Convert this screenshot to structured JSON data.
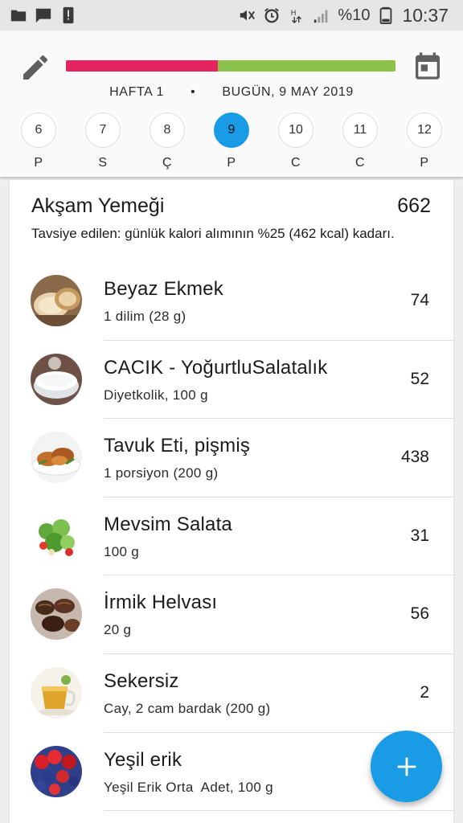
{
  "status_bar": {
    "battery_text": "%10",
    "time": "10:37",
    "left_icons": [
      "folder-icon",
      "chat-icon",
      "alert-icon"
    ],
    "right_icons": [
      "mute-icon",
      "alarm-icon",
      "data-icon",
      "signal-icon",
      "battery-icon"
    ]
  },
  "header": {
    "week_label": "HAFTA 1",
    "separator": "•",
    "date_label": "BUGÜN, 9 MAY 2019",
    "progress": {
      "consumed_fraction": 0.46,
      "consumed_color": "#e5245f",
      "remaining_color": "#8bc34a"
    },
    "days": [
      {
        "number": "6",
        "name": "P",
        "active": false
      },
      {
        "number": "7",
        "name": "S",
        "active": false
      },
      {
        "number": "8",
        "name": "Ç",
        "active": false
      },
      {
        "number": "9",
        "name": "P",
        "active": true
      },
      {
        "number": "10",
        "name": "C",
        "active": false
      },
      {
        "number": "11",
        "name": "C",
        "active": false
      },
      {
        "number": "12",
        "name": "P",
        "active": false
      }
    ],
    "accent_color": "#1a9be6"
  },
  "meal": {
    "title": "Akşam Yemeği",
    "total": "662",
    "note": "Tavsiye edilen: günlük kalori alımının %25 (462 kcal) kadarı.",
    "items": [
      {
        "name": "Beyaz Ekmek",
        "portion": "1 dilim (28 g)",
        "kcal": "74",
        "icon": "bread-icon"
      },
      {
        "name": "CACIK - YoğurtluSalatalık",
        "portion": "Diyetkolik, 100 g",
        "kcal": "52",
        "icon": "yogurt-icon"
      },
      {
        "name": "Tavuk Eti, pişmiş",
        "portion": "1 porsiyon (200 g)",
        "kcal": "438",
        "icon": "chicken-icon"
      },
      {
        "name": "Mevsim Salata",
        "portion": "100 g",
        "kcal": "31",
        "icon": "salad-icon"
      },
      {
        "name": "İrmik Helvası",
        "portion": "20 g",
        "kcal": "56",
        "icon": "dessert-icon"
      },
      {
        "name": "Sekersiz",
        "portion": "Cay, 2 cam bardak (200 g)",
        "kcal": "2",
        "icon": "tea-icon"
      },
      {
        "name": "Yeşil  erik",
        "portion": "Yeşil Erik Orta  Adet, 100 g",
        "kcal": "",
        "icon": "berries-icon"
      }
    ]
  },
  "fab": {
    "icon": "plus-icon"
  }
}
